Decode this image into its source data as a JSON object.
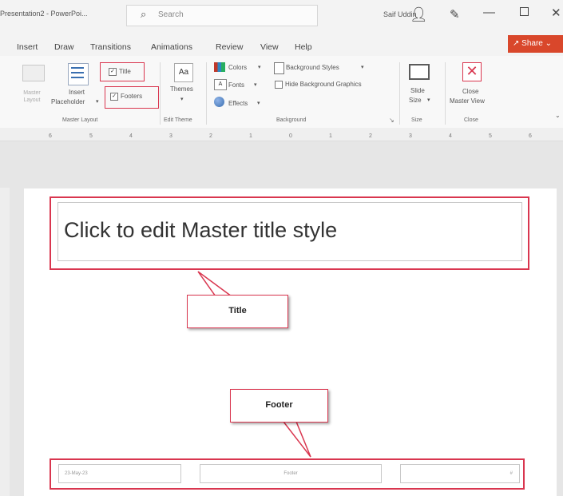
{
  "titlebar": {
    "doc_title": "Presentation2 - PowerPoi...",
    "search_placeholder": "Search",
    "user_name": "Saif Uddin",
    "minimize": "—",
    "close": "✕"
  },
  "menu": {
    "tabs": [
      "Insert",
      "Draw",
      "Transitions",
      "Animations",
      "Review",
      "View",
      "Help"
    ],
    "share": "Share"
  },
  "ribbon": {
    "master_layout": {
      "master_layout_btn": "Master Layout",
      "insert_label": "Insert",
      "placeholder_label": "Placeholder",
      "title_checkbox": "Title",
      "footers_checkbox": "Footers",
      "group_label": "Master Layout"
    },
    "edit_theme": {
      "themes": "Themes",
      "group_label": "Edit Theme"
    },
    "background": {
      "colors": "Colors",
      "fonts": "Fonts",
      "effects": "Effects",
      "background_styles": "Background Styles",
      "hide_background_graphics": "Hide Background Graphics",
      "group_label": "Background"
    },
    "size": {
      "slide_label": "Slide",
      "size_label": "Size",
      "group_label": "Size"
    },
    "close": {
      "close_label": "Close",
      "master_view_label": "Master View",
      "group_label": "Close"
    }
  },
  "ruler": {
    "numbers": [
      "6",
      "5",
      "4",
      "3",
      "2",
      "1",
      "0",
      "1",
      "2",
      "3",
      "4",
      "5",
      "6"
    ]
  },
  "slide": {
    "title_placeholder": "Click to edit Master title style",
    "title_callout": "Title",
    "footer_callout": "Footer",
    "footer_date": "23-May-23",
    "footer_center": "Footer",
    "footer_number": "#"
  },
  "colors": {
    "annotation_red": "#d9364f",
    "share_button": "#d9472b"
  }
}
